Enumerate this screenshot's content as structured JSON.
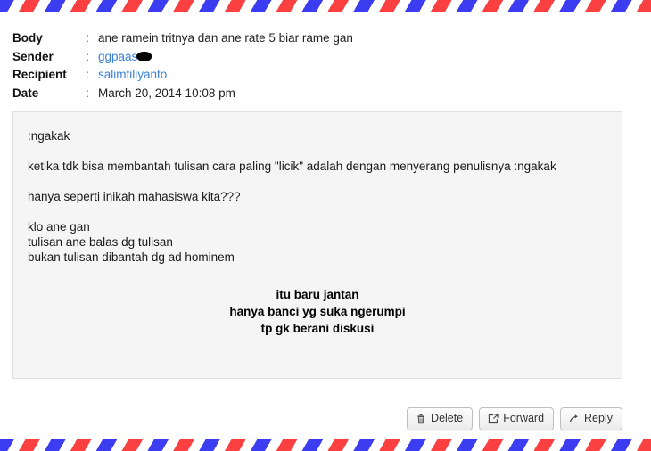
{
  "decor": {
    "stripe_red": "#fa4040",
    "stripe_blue": "#3c3cf0",
    "pattern_name": "airmail-stripes"
  },
  "meta": {
    "separator": ":",
    "rows": [
      {
        "label": "Body",
        "value": "ane ramein tritnya dan ane rate 5 biar rame gan",
        "type": "text"
      },
      {
        "label": "Sender",
        "value": "ggpaas",
        "type": "link",
        "redacted": true
      },
      {
        "label": "Recipient",
        "value": "salimfiliyanto",
        "type": "link",
        "redacted": false
      },
      {
        "label": "Date",
        "value": "March 20, 2014 10:08 pm",
        "type": "text"
      }
    ]
  },
  "message": {
    "lines": [
      ":ngakak",
      "",
      "ketika tdk bisa membantah tulisan cara paling \"licik\" adalah dengan menyerang penulisnya :ngakak",
      "",
      "hanya seperti inikah mahasiswa kita???",
      "",
      "klo ane gan",
      "tulisan ane balas dg tulisan",
      "bukan tulisan dibantah dg ad hominem"
    ],
    "centered_lines": [
      "itu baru jantan",
      "hanya banci yg suka ngerumpi",
      "tp gk berani diskusi"
    ]
  },
  "actions": {
    "buttons": [
      {
        "label": "Delete",
        "icon": "trash-icon"
      },
      {
        "label": "Forward",
        "icon": "share-box-icon"
      },
      {
        "label": "Reply",
        "icon": "reply-arrow-icon"
      }
    ]
  }
}
